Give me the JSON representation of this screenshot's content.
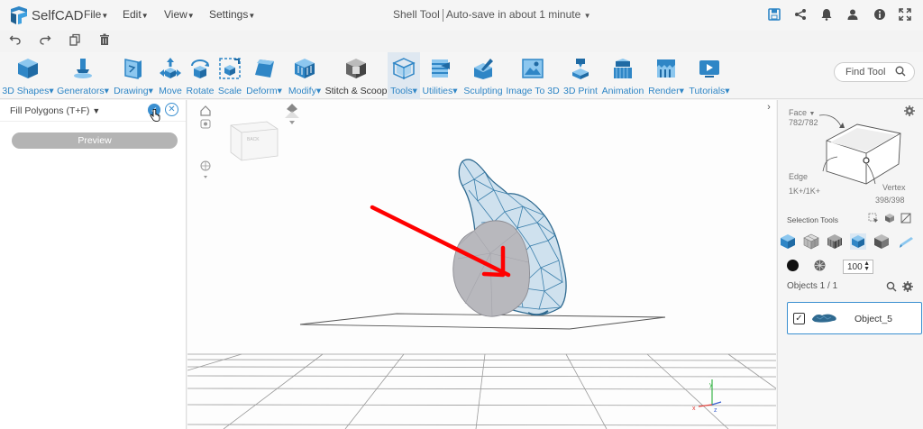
{
  "app": {
    "name": "SelfCAD",
    "brand_color": "#2f86c6"
  },
  "menu": [
    {
      "label": "File"
    },
    {
      "label": "Edit"
    },
    {
      "label": "View"
    },
    {
      "label": "Settings"
    }
  ],
  "title": {
    "tool": "Shell Tool",
    "autosave": "Auto-save in about 1 minute"
  },
  "top_icons": [
    "save-icon",
    "share-icon",
    "bell-icon",
    "user-icon",
    "info-icon",
    "fullscreen-icon"
  ],
  "edit_icons": [
    "undo-icon",
    "redo-icon",
    "copy-icon",
    "delete-icon"
  ],
  "toolbar": [
    {
      "label": "3D Shapes",
      "caret": true,
      "icon": "cube-icon"
    },
    {
      "label": "Generators",
      "caret": true,
      "icon": "generator-icon"
    },
    {
      "label": "Drawing",
      "caret": true,
      "icon": "drawing-icon"
    },
    {
      "label": "Move",
      "caret": false,
      "icon": "move-icon"
    },
    {
      "label": "Rotate",
      "caret": false,
      "icon": "rotate-icon"
    },
    {
      "label": "Scale",
      "caret": false,
      "icon": "scale-icon"
    },
    {
      "label": "Deform",
      "caret": true,
      "icon": "deform-icon"
    },
    {
      "label": "Modify",
      "caret": true,
      "icon": "modify-icon"
    },
    {
      "label": "Stitch & Scoop",
      "caret": false,
      "icon": "stitch-icon"
    },
    {
      "label": "Tools",
      "caret": true,
      "icon": "tools-icon"
    },
    {
      "label": "Utilities",
      "caret": true,
      "icon": "utilities-icon"
    },
    {
      "label": "Sculpting",
      "caret": false,
      "icon": "sculpting-icon"
    },
    {
      "label": "Image To 3D",
      "caret": false,
      "icon": "image-to-3d-icon"
    },
    {
      "label": "3D Print",
      "caret": false,
      "icon": "3d-print-icon"
    },
    {
      "label": "Animation",
      "caret": false,
      "icon": "animation-icon"
    },
    {
      "label": "Render",
      "caret": true,
      "icon": "render-icon"
    },
    {
      "label": "Tutorials",
      "caret": true,
      "icon": "tutorials-icon"
    }
  ],
  "find_tool": {
    "placeholder": "Find Tool"
  },
  "left_panel": {
    "title": "Fill Polygons (T+F)",
    "preview_label": "Preview"
  },
  "right_panel": {
    "face_label": "Face",
    "face_count": "782/782",
    "edge_label": "Edge",
    "edge_count": "1K+/1K+",
    "vertex_label": "Vertex",
    "vertex_count": "398/398",
    "selection_tools_label": "Selection Tools",
    "opacity_value": "100",
    "objects_label": "Objects 1 / 1",
    "object_name": "Object_5"
  },
  "colors": {
    "mesh": "#5b95bd",
    "mesh_dark": "#2f6a90",
    "arrow": "#ff0000",
    "face": "#b8b8bd"
  }
}
